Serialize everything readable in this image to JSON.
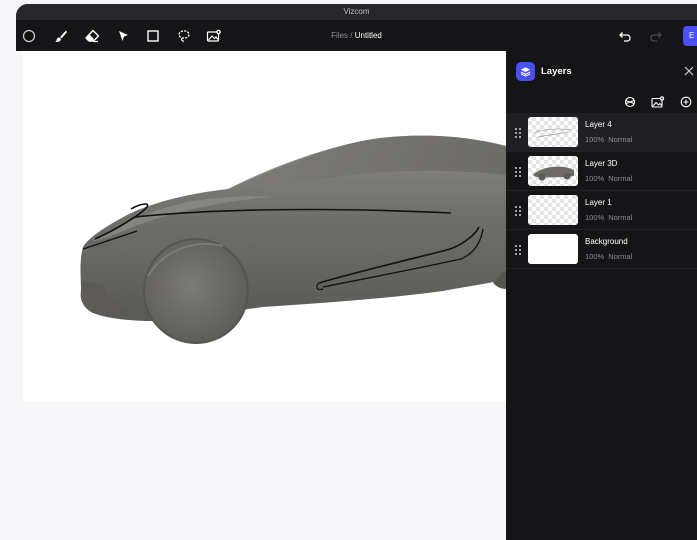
{
  "app": {
    "title": "Vizcom"
  },
  "toolbar": {
    "tools": [
      {
        "name": "color-swatch"
      },
      {
        "name": "brush-icon"
      },
      {
        "name": "eraser-icon"
      },
      {
        "name": "select-arrow-icon"
      },
      {
        "name": "rectangle-icon"
      },
      {
        "name": "lasso-icon"
      },
      {
        "name": "image-icon"
      }
    ],
    "breadcrumb": {
      "parent": "Files",
      "separator": " / ",
      "current": "Untitled"
    },
    "export_label": "E"
  },
  "layers_panel": {
    "title": "Layers",
    "layers": [
      {
        "name": "Layer 4",
        "opacity": "100%",
        "blend": "Normal",
        "thumb": "sketch",
        "selected": true
      },
      {
        "name": "Layer 3D",
        "opacity": "100%",
        "blend": "Normal",
        "thumb": "car",
        "selected": false
      },
      {
        "name": "Layer 1",
        "opacity": "100%",
        "blend": "Normal",
        "thumb": "empty",
        "selected": false
      },
      {
        "name": "Background",
        "opacity": "100%",
        "blend": "Normal",
        "thumb": "white",
        "selected": false
      }
    ]
  },
  "colors": {
    "accent": "#4a4ff2",
    "panel_bg": "#151518",
    "toolbar_bg": "#151518",
    "car_body": "#6b6a66"
  }
}
